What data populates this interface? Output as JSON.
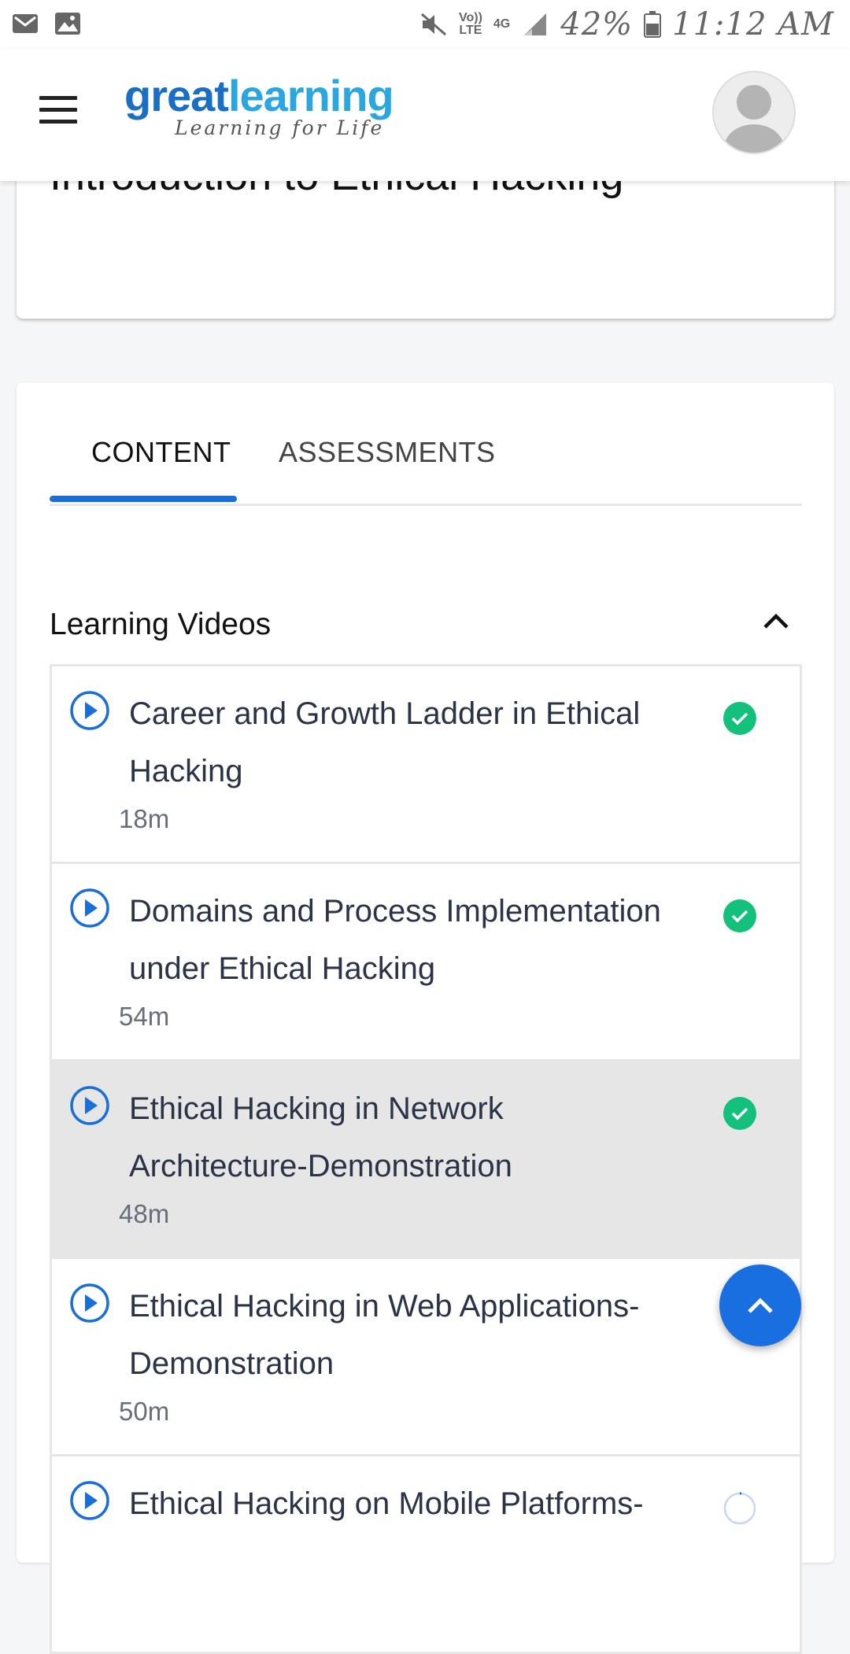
{
  "status_bar": {
    "battery": "42%",
    "time": "11:12 AM",
    "network_top": "Vo))",
    "network_bottom": "LTE",
    "signal": "4G",
    "icons": [
      "mail-icon",
      "image-icon",
      "mute-icon",
      "signal-icon",
      "battery-icon"
    ]
  },
  "header": {
    "logo_part1": "great",
    "logo_part2": "learning",
    "tagline": "Learning for Life",
    "icons": [
      "menu-icon",
      "avatar-icon"
    ]
  },
  "course": {
    "title": "Introduction to Ethical Hacking"
  },
  "tabs": [
    {
      "label": "CONTENT",
      "active": true
    },
    {
      "label": "ASSESSMENTS",
      "active": false
    }
  ],
  "section": {
    "title": "Learning Videos",
    "expanded": true
  },
  "videos": [
    {
      "title": "Career and Growth Ladder in Ethical Hacking",
      "duration": "18m",
      "status": "completed",
      "active": false
    },
    {
      "title": "Domains and Process Implementation under Ethical Hacking",
      "duration": "54m",
      "status": "completed",
      "active": false
    },
    {
      "title": "Ethical Hacking in Network Architecture-Demonstration",
      "duration": "48m",
      "status": "completed",
      "active": true
    },
    {
      "title": "Ethical Hacking in Web Applications-Demonstration",
      "duration": "50m",
      "status": "completed",
      "active": false
    },
    {
      "title": "Ethical Hacking on Mobile Platforms-",
      "duration": "",
      "status": "in-progress",
      "active": false
    }
  ],
  "colors": {
    "accent": "#1a6fd6",
    "success": "#13c07c",
    "active_row": "#e6e6e6"
  }
}
